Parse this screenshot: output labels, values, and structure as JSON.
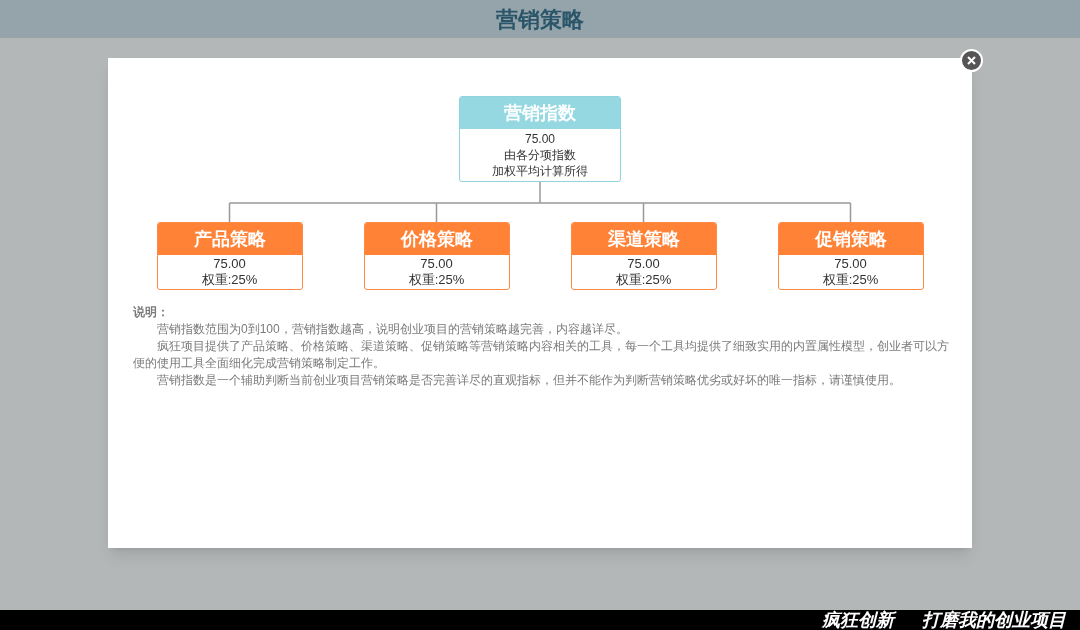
{
  "header": {
    "title": "营销策略"
  },
  "tree": {
    "root": {
      "title": "营销指数",
      "value": "75.00",
      "description": [
        "由各分项指数",
        "加权平均计算所得"
      ]
    },
    "children": [
      {
        "title": "产品策略",
        "value": "75.00",
        "weight": "权重:25%"
      },
      {
        "title": "价格策略",
        "value": "75.00",
        "weight": "权重:25%"
      },
      {
        "title": "渠道策略",
        "value": "75.00",
        "weight": "权重:25%"
      },
      {
        "title": "促销策略",
        "value": "75.00",
        "weight": "权重:25%"
      }
    ]
  },
  "explanation": {
    "heading": "说明：",
    "paragraphs": [
      "营销指数范围为0到100，营销指数越高，说明创业项目的营销策略越完善，内容越详尽。",
      "疯狂项目提供了产品策略、价格策略、渠道策略、促销策略等营销策略内容相关的工具，每一个工具均提供了细致实用的内置属性模型，创业者可以方便的使用工具全面细化完成营销策略制定工作。",
      "营销指数是一个辅助判断当前创业项目营销策略是否完善详尽的直观指标，但并不能作为判断营销策略优劣或好坏的唯一指标，请谨慎使用。"
    ]
  },
  "footer": {
    "slogans": [
      "疯狂创新",
      "打磨我的创业项目"
    ]
  }
}
